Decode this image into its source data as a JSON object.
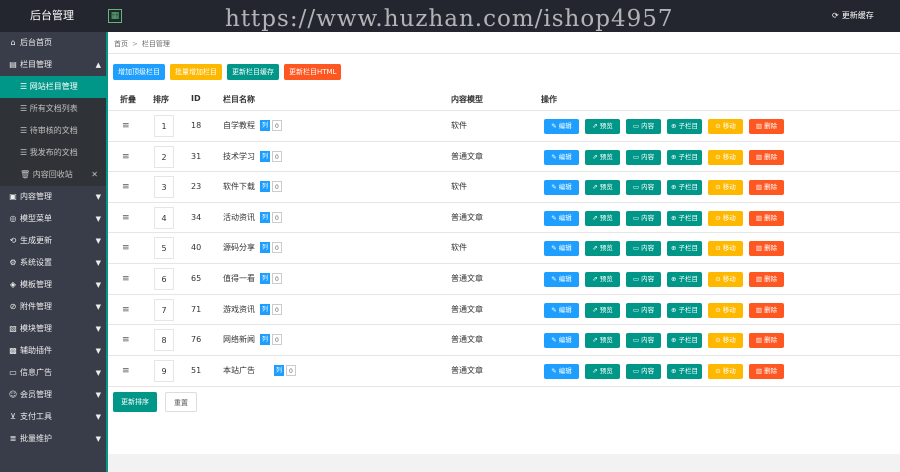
{
  "topbar": {
    "brand": "后台管理",
    "toggle_icon": "grid-icon",
    "watermark": "https://www.huzhan.com/ishop4957",
    "update_label": "更新缓存"
  },
  "sidebar": {
    "items": [
      {
        "label": "后台首页",
        "icon": "home-icon",
        "caret": ""
      },
      {
        "label": "栏目管理",
        "icon": "list-icon",
        "caret": "▲"
      }
    ],
    "sub_items": [
      {
        "label": "网站栏目管理",
        "active": true
      },
      {
        "label": "所有文档列表"
      },
      {
        "label": "待审核的文档"
      },
      {
        "label": "我发布的文档"
      },
      {
        "label": "内容回收站",
        "close": "✕"
      }
    ],
    "more_items": [
      {
        "label": "内容管理",
        "icon": "doc-icon",
        "caret": "▼"
      },
      {
        "label": "模型菜单",
        "icon": "globe-icon",
        "caret": "▼"
      },
      {
        "label": "生成更新",
        "icon": "refresh-icon",
        "caret": "▼"
      },
      {
        "label": "系统设置",
        "icon": "gear-icon",
        "caret": "▼"
      },
      {
        "label": "模板管理",
        "icon": "template-icon",
        "caret": "▼"
      },
      {
        "label": "附件管理",
        "icon": "attach-icon",
        "caret": "▼"
      },
      {
        "label": "模块管理",
        "icon": "module-icon",
        "caret": "▼"
      },
      {
        "label": "辅助插件",
        "icon": "plugin-icon",
        "caret": "▼"
      },
      {
        "label": "信息广告",
        "icon": "ad-icon",
        "caret": "▼"
      },
      {
        "label": "会员管理",
        "icon": "user-icon",
        "caret": "▼"
      },
      {
        "label": "支付工具",
        "icon": "cart-icon",
        "caret": "▼"
      },
      {
        "label": "批量维护",
        "icon": "batch-icon",
        "caret": "▼"
      }
    ]
  },
  "breadcrumb": {
    "home": "首页",
    "separator": ">",
    "current": "栏目管理"
  },
  "toolbar": {
    "add_top": "增加顶级栏目",
    "batch_add": "批量增加栏目",
    "update_sort": "更新栏目缓存",
    "update_html": "更新栏目HTML"
  },
  "table": {
    "headers": {
      "fold": "折叠",
      "sort": "排序",
      "id": "ID",
      "name": "栏目名称",
      "model": "内容模型",
      "ops": "操作"
    },
    "rows": [
      {
        "drag": "≡",
        "sort": "1",
        "id": "18",
        "name": "自学教程",
        "list": "列",
        "count": "0",
        "model": "软件"
      },
      {
        "drag": "≡",
        "sort": "2",
        "id": "31",
        "name": "技术学习",
        "list": "列",
        "count": "0",
        "model": "普通文章"
      },
      {
        "drag": "≡",
        "sort": "3",
        "id": "23",
        "name": "软件下载",
        "list": "列",
        "count": "0",
        "model": "软件"
      },
      {
        "drag": "≡",
        "sort": "4",
        "id": "34",
        "name": "活动资讯",
        "list": "列",
        "count": "0",
        "model": "普通文章"
      },
      {
        "drag": "≡",
        "sort": "5",
        "id": "40",
        "name": "源码分享",
        "list": "列",
        "count": "0",
        "model": "软件"
      },
      {
        "drag": "≡",
        "sort": "6",
        "id": "65",
        "name": "值得一看",
        "list": "列",
        "count": "0",
        "model": "普通文章"
      },
      {
        "drag": "≡",
        "sort": "7",
        "id": "71",
        "name": "游戏资讯",
        "list": "列",
        "count": "0",
        "model": "普通文章"
      },
      {
        "drag": "≡",
        "sort": "8",
        "id": "76",
        "name": "网络新闻",
        "list": "列",
        "count": "0",
        "model": "普通文章"
      },
      {
        "drag": "≡",
        "sort": "9",
        "id": "51",
        "name": "本站广告",
        "list": "列",
        "count": "0",
        "model": "普通文章"
      }
    ],
    "ops": {
      "edit": "✎ 编辑",
      "preview": "⇗ 预览",
      "content": "▭ 内容",
      "child": "⊕ 子栏目",
      "move": "⊙ 移动",
      "delete": "▥ 删除"
    }
  },
  "footer": {
    "update_sort": "更新排序",
    "reset": "重置"
  },
  "colors": {
    "green": "#009688",
    "blue": "#1e9fff",
    "yellow": "#ffb800",
    "red": "#ff5722",
    "sidebar": "#393d49",
    "topbar": "#23262e"
  }
}
